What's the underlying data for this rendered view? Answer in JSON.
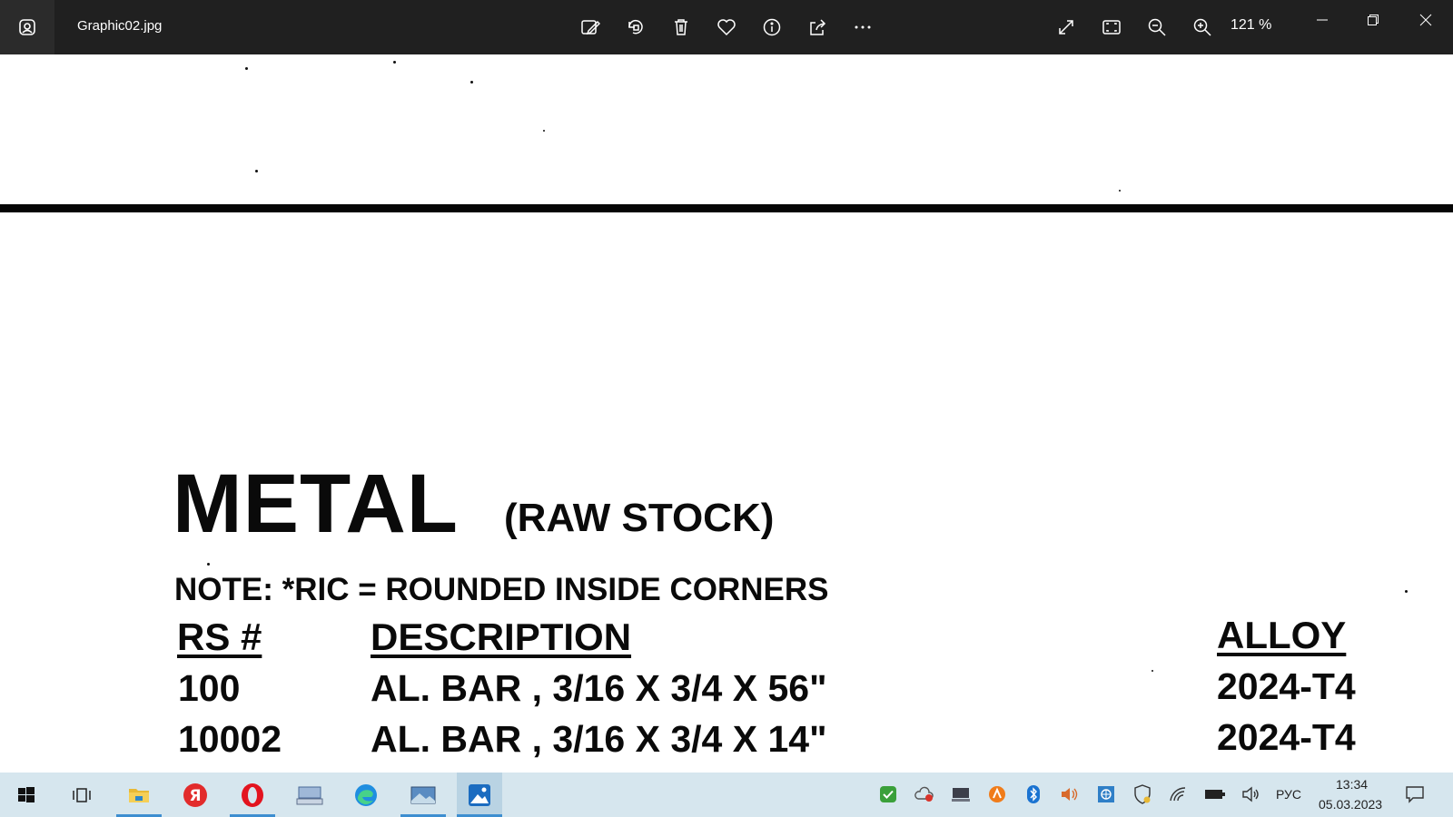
{
  "window": {
    "file_name": "Graphic02.jpg",
    "zoom_level": "121 %"
  },
  "toolbar": {
    "icons": [
      "edit-image-icon",
      "rotate-icon",
      "delete-icon",
      "favorite-icon",
      "info-icon",
      "share-icon",
      "more-icon"
    ],
    "view_icons": [
      "fullscreen-icon",
      "fit-to-window-icon",
      "zoom-out-icon",
      "zoom-in-icon"
    ],
    "window_controls": [
      "minimize-icon",
      "restore-icon",
      "close-icon"
    ]
  },
  "document": {
    "title": "METAL",
    "subtitle": "(RAW STOCK)",
    "note": "NOTE: *RIC = ROUNDED INSIDE CORNERS",
    "columns": [
      "RS #",
      "DESCRIPTION",
      "ALLOY"
    ],
    "rows": [
      {
        "rs": "100",
        "description": "AL. BAR , 3/16 X 3/4 X 56\"",
        "alloy": "2024-T4"
      },
      {
        "rs": "10002",
        "description": "AL. BAR , 3/16 X 3/4 X 14\"",
        "alloy": "2024-T4"
      }
    ]
  },
  "taskbar": {
    "apps": [
      "windows-start-icon",
      "task-view-icon",
      "file-explorer-icon",
      "yandex-browser-icon",
      "opera-browser-icon",
      "keyboard-app-icon",
      "edge-browser-icon",
      "image-app-icon",
      "photos-app-icon"
    ],
    "tray_icons": [
      "shield-check-icon",
      "cloud-alert-icon",
      "monitor-icon",
      "avast-icon",
      "bluetooth-icon",
      "volume-icon",
      "network-app-icon",
      "security-icon",
      "wifi-icon",
      "battery-icon",
      "speaker-icon"
    ],
    "language": "РУС",
    "time": "13:34",
    "date": "05.03.2023"
  },
  "colors": {
    "titlebar_bg": "#202020",
    "taskbar_bg": "#d6e6ee",
    "accent": "#2b78c2"
  }
}
